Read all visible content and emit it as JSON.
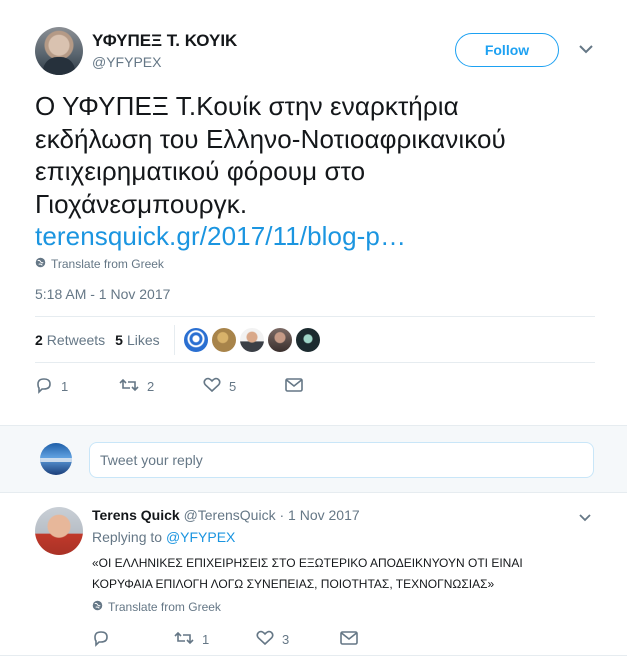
{
  "author": {
    "name": "ΥΦΥΠΕΞ Τ. ΚΟΥΙΚ",
    "handle": "@YFYPEX"
  },
  "follow_label": "Follow",
  "tweet": {
    "lines": [
      "Ο ΥΦΥΠΕΞ Τ.Κουίκ στην εναρκτήρια",
      "εκδήλωση του Ελληνο-Νοτιοαφρικανικού",
      "επιχειρηματικού φόρουμ στο",
      "Γιοχάνεσμπουργκ."
    ],
    "link": "terensquick.gr/2017/11/blog-p…",
    "translate": "Translate from Greek",
    "timestamp": "5:18 AM - 1 Nov 2017"
  },
  "stats": {
    "retweets_count": "2",
    "retweets_label": "Retweets",
    "likes_count": "5",
    "likes_label": "Likes"
  },
  "likers": [
    {
      "icon": "broadcast-avatar",
      "color": "#2a6fd1"
    },
    {
      "icon": "painting-avatar",
      "color": "#a8844a"
    },
    {
      "icon": "person-avatar",
      "color": "#3a3f46"
    },
    {
      "icon": "person-avatar",
      "color": "#6b5a55"
    },
    {
      "icon": "dark-avatar",
      "color": "#1c2b2f"
    }
  ],
  "actions": {
    "replies": "1",
    "retweets": "2",
    "likes": "5"
  },
  "reply_placeholder": "Tweet your reply",
  "reply_tweet": {
    "name": "Terens Quick",
    "handle": "@TerensQuick",
    "dot": "·",
    "date": "1 Nov 2017",
    "replying_prefix": "Replying to",
    "replying_to": "@YFYPEX",
    "text_line1": "«ΟΙ ΕΛΛΗΝΙΚΕΣ ΕΠΙΧΕΙΡΗΣΕΙΣ ΣΤΟ ΕΞΩΤΕΡΙΚΟ ΑΠΟΔΕΙΚΝΥΟΥΝ ΟΤΙ ΕΙΝΑΙ",
    "text_line2": "ΚΟΡΥΦΑΙΑ ΕΠΙΛΟΓΗ ΛΟΓΩ ΣΥΝΕΠΕΙΑΣ, ΠΟΙΟΤΗΤΑΣ, ΤΕΧΝΟΓΝΩΣΙΑΣ»",
    "translate": "Translate from Greek",
    "actions": {
      "replies": "",
      "retweets": "1",
      "likes": "3"
    }
  },
  "colors": {
    "accent": "#1da1f2",
    "link": "#1b95e0",
    "muted": "#657786"
  }
}
